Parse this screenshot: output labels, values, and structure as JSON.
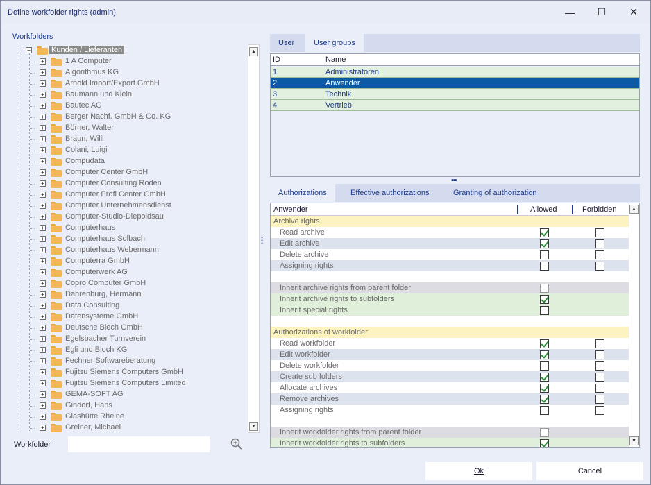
{
  "window": {
    "title": "Define workfolder rights (admin)",
    "controls": {
      "minimize": "—",
      "maximize": "☐",
      "close": "✕"
    }
  },
  "left": {
    "heading": "Workfolders",
    "root": "Kunden / Lieferanten",
    "items": [
      "1 A Computer",
      "Algorithmus KG",
      "Arnold Import/Export GmbH",
      "Baumann und Klein",
      "Bautec AG",
      "Berger Nachf. GmbH & Co. KG",
      "Börner, Walter",
      "Braun, Willi",
      "Colani, Luigi",
      "Compudata",
      "Computer Center GmbH",
      "Computer Consulting Roden",
      "Computer Profi Center GmbH",
      "Computer Unternehmensdienst",
      "Computer-Studio-Diepoldsau",
      "Computerhaus",
      "Computerhaus  Solbach",
      "Computerhaus  Webermann",
      "Computerra GmbH",
      "Computerwerk AG",
      "Copro Computer GmbH",
      "Dahrenburg, Hermann",
      "Data Consulting",
      "Datensysteme GmbH",
      "Deutsche Blech GmbH",
      "Egelsbacher Turnverein",
      "Egli und Bloch KG",
      "Fechner Softwareberatung",
      "Fujitsu Siemens Computers GmbH",
      "Fujitsu Siemens Computers Limited",
      "GEMA-SOFT AG",
      "Gindorf, Hans",
      "Glashütte Rheine",
      "Greiner, Michael"
    ],
    "workfolder_label": "Workfolder",
    "workfolder_value": ""
  },
  "users": {
    "tabs": [
      "User",
      "User groups"
    ],
    "active_tab": 1,
    "columns": [
      "ID",
      "Name"
    ],
    "rows": [
      {
        "id": "1",
        "name": "Administratoren"
      },
      {
        "id": "2",
        "name": "Anwender"
      },
      {
        "id": "3",
        "name": "Technik"
      },
      {
        "id": "4",
        "name": "Vertrieb"
      }
    ],
    "selected_index": 1
  },
  "auth": {
    "tabs": [
      "Authorizations",
      "Effective authorizations",
      "Granting of authorization"
    ],
    "active_tab": 0,
    "header": {
      "name": "Anwender",
      "allowed": "Allowed",
      "forbidden": "Forbidden"
    },
    "rows": [
      {
        "type": "section",
        "label": "Archive rights"
      },
      {
        "type": "item",
        "style": "white",
        "label": "Read archive",
        "allowed": true,
        "forbidden": false
      },
      {
        "type": "item",
        "style": "alt",
        "label": "Edit archive",
        "allowed": true,
        "forbidden": false
      },
      {
        "type": "item",
        "style": "white",
        "label": "Delete archive",
        "allowed": false,
        "forbidden": false
      },
      {
        "type": "item",
        "style": "alt",
        "label": "Assigning rights",
        "allowed": false,
        "forbidden": false
      },
      {
        "type": "blank"
      },
      {
        "type": "inherit",
        "style": "grey",
        "label": "Inherit archive rights from parent folder",
        "allowed": false,
        "dim": true
      },
      {
        "type": "inherit",
        "style": "green",
        "label": "Inherit archive rights to subfolders",
        "allowed": true
      },
      {
        "type": "inherit",
        "style": "green",
        "label": "Inherit special rights",
        "allowed": false
      },
      {
        "type": "blank"
      },
      {
        "type": "section",
        "label": "Authorizations of workfolder"
      },
      {
        "type": "item",
        "style": "white",
        "label": "Read workfolder",
        "allowed": true,
        "forbidden": false
      },
      {
        "type": "item",
        "style": "alt",
        "label": "Edit workfolder",
        "allowed": true,
        "forbidden": false
      },
      {
        "type": "item",
        "style": "white",
        "label": "Delete workfolder",
        "allowed": false,
        "forbidden": false
      },
      {
        "type": "item",
        "style": "alt",
        "label": "Create sub folders",
        "allowed": true,
        "forbidden": false
      },
      {
        "type": "item",
        "style": "white",
        "label": "Allocate archives",
        "allowed": true,
        "forbidden": false
      },
      {
        "type": "item",
        "style": "alt",
        "label": "Remove archives",
        "allowed": true,
        "forbidden": false
      },
      {
        "type": "item",
        "style": "white",
        "label": "Assigning rights",
        "allowed": false,
        "forbidden": false
      },
      {
        "type": "blank"
      },
      {
        "type": "inherit",
        "style": "grey",
        "label": "Inherit workfolder rights from parent folder",
        "allowed": false,
        "dim": true
      },
      {
        "type": "inherit",
        "style": "green",
        "label": "Inherit workfolder rights to subfolders",
        "allowed": true
      }
    ]
  },
  "buttons": {
    "ok": "Ok",
    "cancel": "Cancel"
  }
}
